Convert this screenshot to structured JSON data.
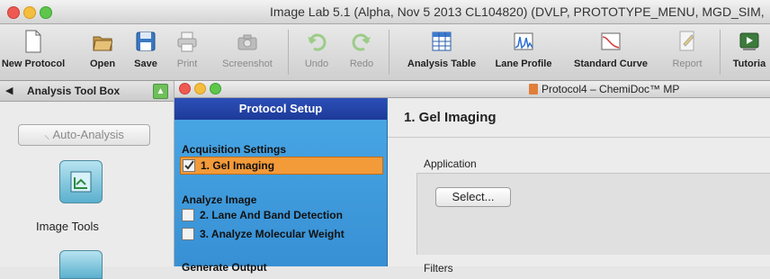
{
  "window": {
    "title": "Image Lab 5.1 (Alpha, Nov  5 2013 CL104820) (DVLP, PROTOTYPE_MENU, MGD_SIM,"
  },
  "toolbar": {
    "items": [
      {
        "label": "New Protocol",
        "icon": "new-document-icon",
        "enabled": true
      },
      {
        "label": "Open",
        "icon": "folder-open-icon",
        "enabled": true
      },
      {
        "label": "Save",
        "icon": "floppy-disk-icon",
        "enabled": true
      },
      {
        "label": "Print",
        "icon": "printer-icon",
        "enabled": false
      },
      {
        "label": "Screenshot",
        "icon": "camera-icon",
        "enabled": false
      },
      {
        "label": "Undo",
        "icon": "undo-arrow-icon",
        "enabled": false
      },
      {
        "label": "Redo",
        "icon": "redo-arrow-icon",
        "enabled": false
      },
      {
        "label": "Analysis Table",
        "icon": "table-icon",
        "enabled": true
      },
      {
        "label": "Lane Profile",
        "icon": "lane-profile-icon",
        "enabled": true
      },
      {
        "label": "Standard Curve",
        "icon": "standard-curve-icon",
        "enabled": true
      },
      {
        "label": "Report",
        "icon": "report-icon",
        "enabled": false
      },
      {
        "label": "Tutoria",
        "icon": "tutorial-icon",
        "enabled": true
      }
    ]
  },
  "left_panel": {
    "title": "Analysis Tool Box",
    "auto_analysis": "Auto-Analysis",
    "image_tools": "Image Tools"
  },
  "inner_window": {
    "title": "Protocol4 – ChemiDoc™ MP"
  },
  "protocol": {
    "title": "Protocol Setup",
    "sections": [
      {
        "title": "Acquisition Settings",
        "items": [
          {
            "label": "1. Gel Imaging",
            "checked": true,
            "selected": true
          }
        ]
      },
      {
        "title": "Analyze Image",
        "items": [
          {
            "label": "2. Lane And Band Detection",
            "checked": false,
            "selected": false
          },
          {
            "label": "3. Analyze Molecular Weight",
            "checked": false,
            "selected": false
          }
        ]
      },
      {
        "title": "Generate Output",
        "items": []
      }
    ]
  },
  "content": {
    "title": "1. Gel Imaging",
    "application_label": "Application",
    "select_button": "Select...",
    "filters_label": "Filters"
  },
  "colors": {
    "protocol_header": "#1d3a98",
    "protocol_bg": "#4aa8e6",
    "selected_item": "#f39a39",
    "close": "#ee5a52",
    "minimize": "#f5bd3d",
    "zoom": "#5ec64b"
  }
}
